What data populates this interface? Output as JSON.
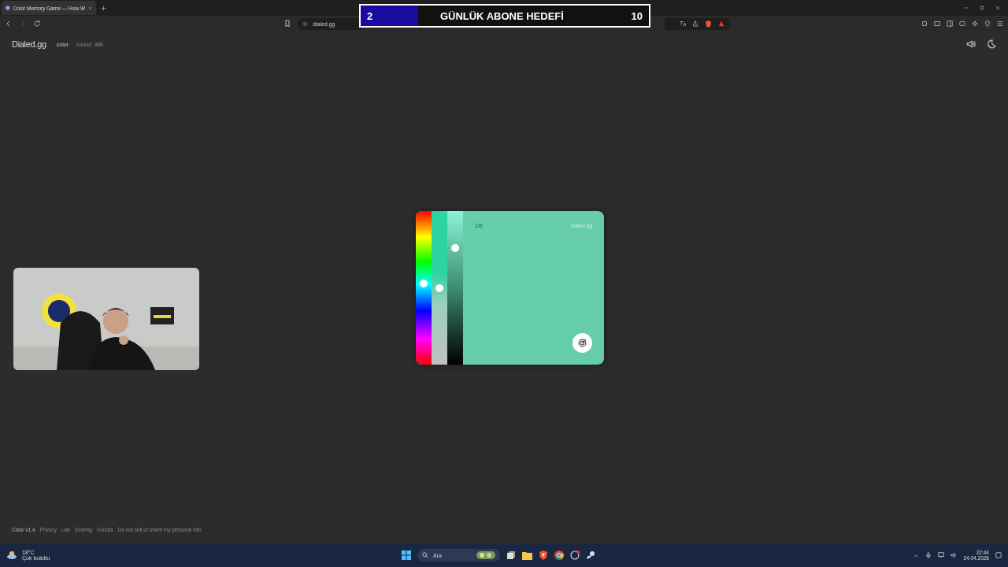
{
  "browser": {
    "tab": {
      "title": "Color Memory Game — How W",
      "selected": true
    },
    "address": "dialed.gg"
  },
  "goal_overlay": {
    "current": "2",
    "title": "GÜNLÜK ABONE HEDEFİ",
    "target": "10",
    "level": 0.2
  },
  "site": {
    "logo": "Dialed.gg",
    "nav": [
      {
        "label": "color",
        "selected": true
      },
      {
        "label": "sound",
        "selected": false
      }
    ]
  },
  "game": {
    "round": "1/5",
    "brand": "Dialed.gg",
    "sliders": [
      {
        "kind": "hue"
      },
      {
        "kind": "saturation",
        "level": 0.5
      },
      {
        "kind": "brightness"
      }
    ]
  },
  "footer": [
    "Color v1.4",
    "Privacy",
    "Lab",
    "Scoring",
    "Socials",
    "Do not sell or share my personal info"
  ],
  "taskbar": {
    "temperature": "18°C",
    "weather": "Çok bulutlu",
    "search_placeholder": "Ara",
    "time": "22:44",
    "date": "24.04.2026"
  }
}
